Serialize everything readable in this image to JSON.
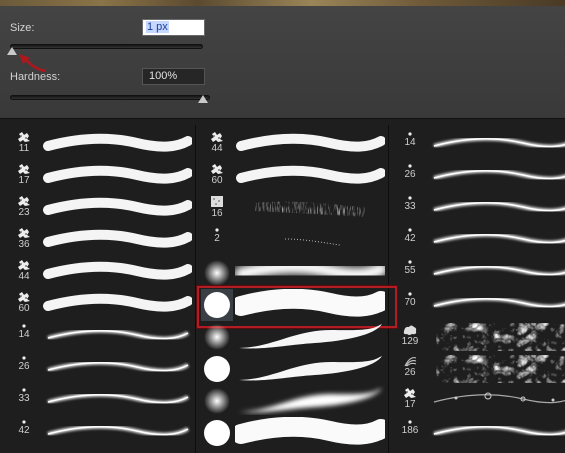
{
  "size": {
    "label": "Size:",
    "value": "1 px"
  },
  "hardness": {
    "label": "Hardness:",
    "value": "100%"
  },
  "columns": [
    {
      "id": "col1",
      "items": [
        {
          "number": "11",
          "tip": "splatter",
          "stroke": "solid"
        },
        {
          "number": "17",
          "tip": "splatter",
          "stroke": "solid"
        },
        {
          "number": "23",
          "tip": "splatter",
          "stroke": "solid"
        },
        {
          "number": "36",
          "tip": "splatter",
          "stroke": "solid"
        },
        {
          "number": "44",
          "tip": "splatter",
          "stroke": "solid"
        },
        {
          "number": "60",
          "tip": "splatter",
          "stroke": "solid"
        },
        {
          "number": "14",
          "tip": "dot",
          "stroke": "thin"
        },
        {
          "number": "26",
          "tip": "dot",
          "stroke": "thin"
        },
        {
          "number": "33",
          "tip": "dot",
          "stroke": "thin"
        },
        {
          "number": "42",
          "tip": "dot",
          "stroke": "thin"
        }
      ]
    },
    {
      "id": "col2",
      "items": [
        {
          "number": "44",
          "tip": "splatter",
          "stroke": "solid"
        },
        {
          "number": "60",
          "tip": "splatter",
          "stroke": "solid"
        },
        {
          "number": "16",
          "tip": "chalk",
          "stroke": "chalk"
        },
        {
          "number": "2",
          "tip": "dot",
          "stroke": "dots"
        },
        {
          "number": "",
          "tip": "soft-round",
          "stroke": "soft"
        },
        {
          "number": "",
          "tip": "hard-round",
          "stroke": "solid-big"
        },
        {
          "number": "",
          "tip": "soft-round",
          "stroke": "taper"
        },
        {
          "number": "",
          "tip": "hard-round",
          "stroke": "taper"
        },
        {
          "number": "",
          "tip": "soft-round",
          "stroke": "soft-taper"
        },
        {
          "number": "",
          "tip": "hard-round",
          "stroke": "solid-big"
        }
      ]
    },
    {
      "id": "col3",
      "items": [
        {
          "number": "14",
          "tip": "dot",
          "stroke": "thin"
        },
        {
          "number": "26",
          "tip": "dot",
          "stroke": "thin"
        },
        {
          "number": "33",
          "tip": "dot",
          "stroke": "thin"
        },
        {
          "number": "42",
          "tip": "dot",
          "stroke": "thin"
        },
        {
          "number": "55",
          "tip": "dot",
          "stroke": "thin"
        },
        {
          "number": "70",
          "tip": "dot",
          "stroke": "thin"
        },
        {
          "number": "129",
          "tip": "cloud",
          "stroke": "cloud"
        },
        {
          "number": "26",
          "tip": "fan",
          "stroke": "cloud"
        },
        {
          "number": "17",
          "tip": "splatter",
          "stroke": "sparkle"
        },
        {
          "number": "186",
          "tip": "dot",
          "stroke": "thin"
        }
      ]
    }
  ],
  "selected": {
    "column": 1,
    "row": 5
  }
}
